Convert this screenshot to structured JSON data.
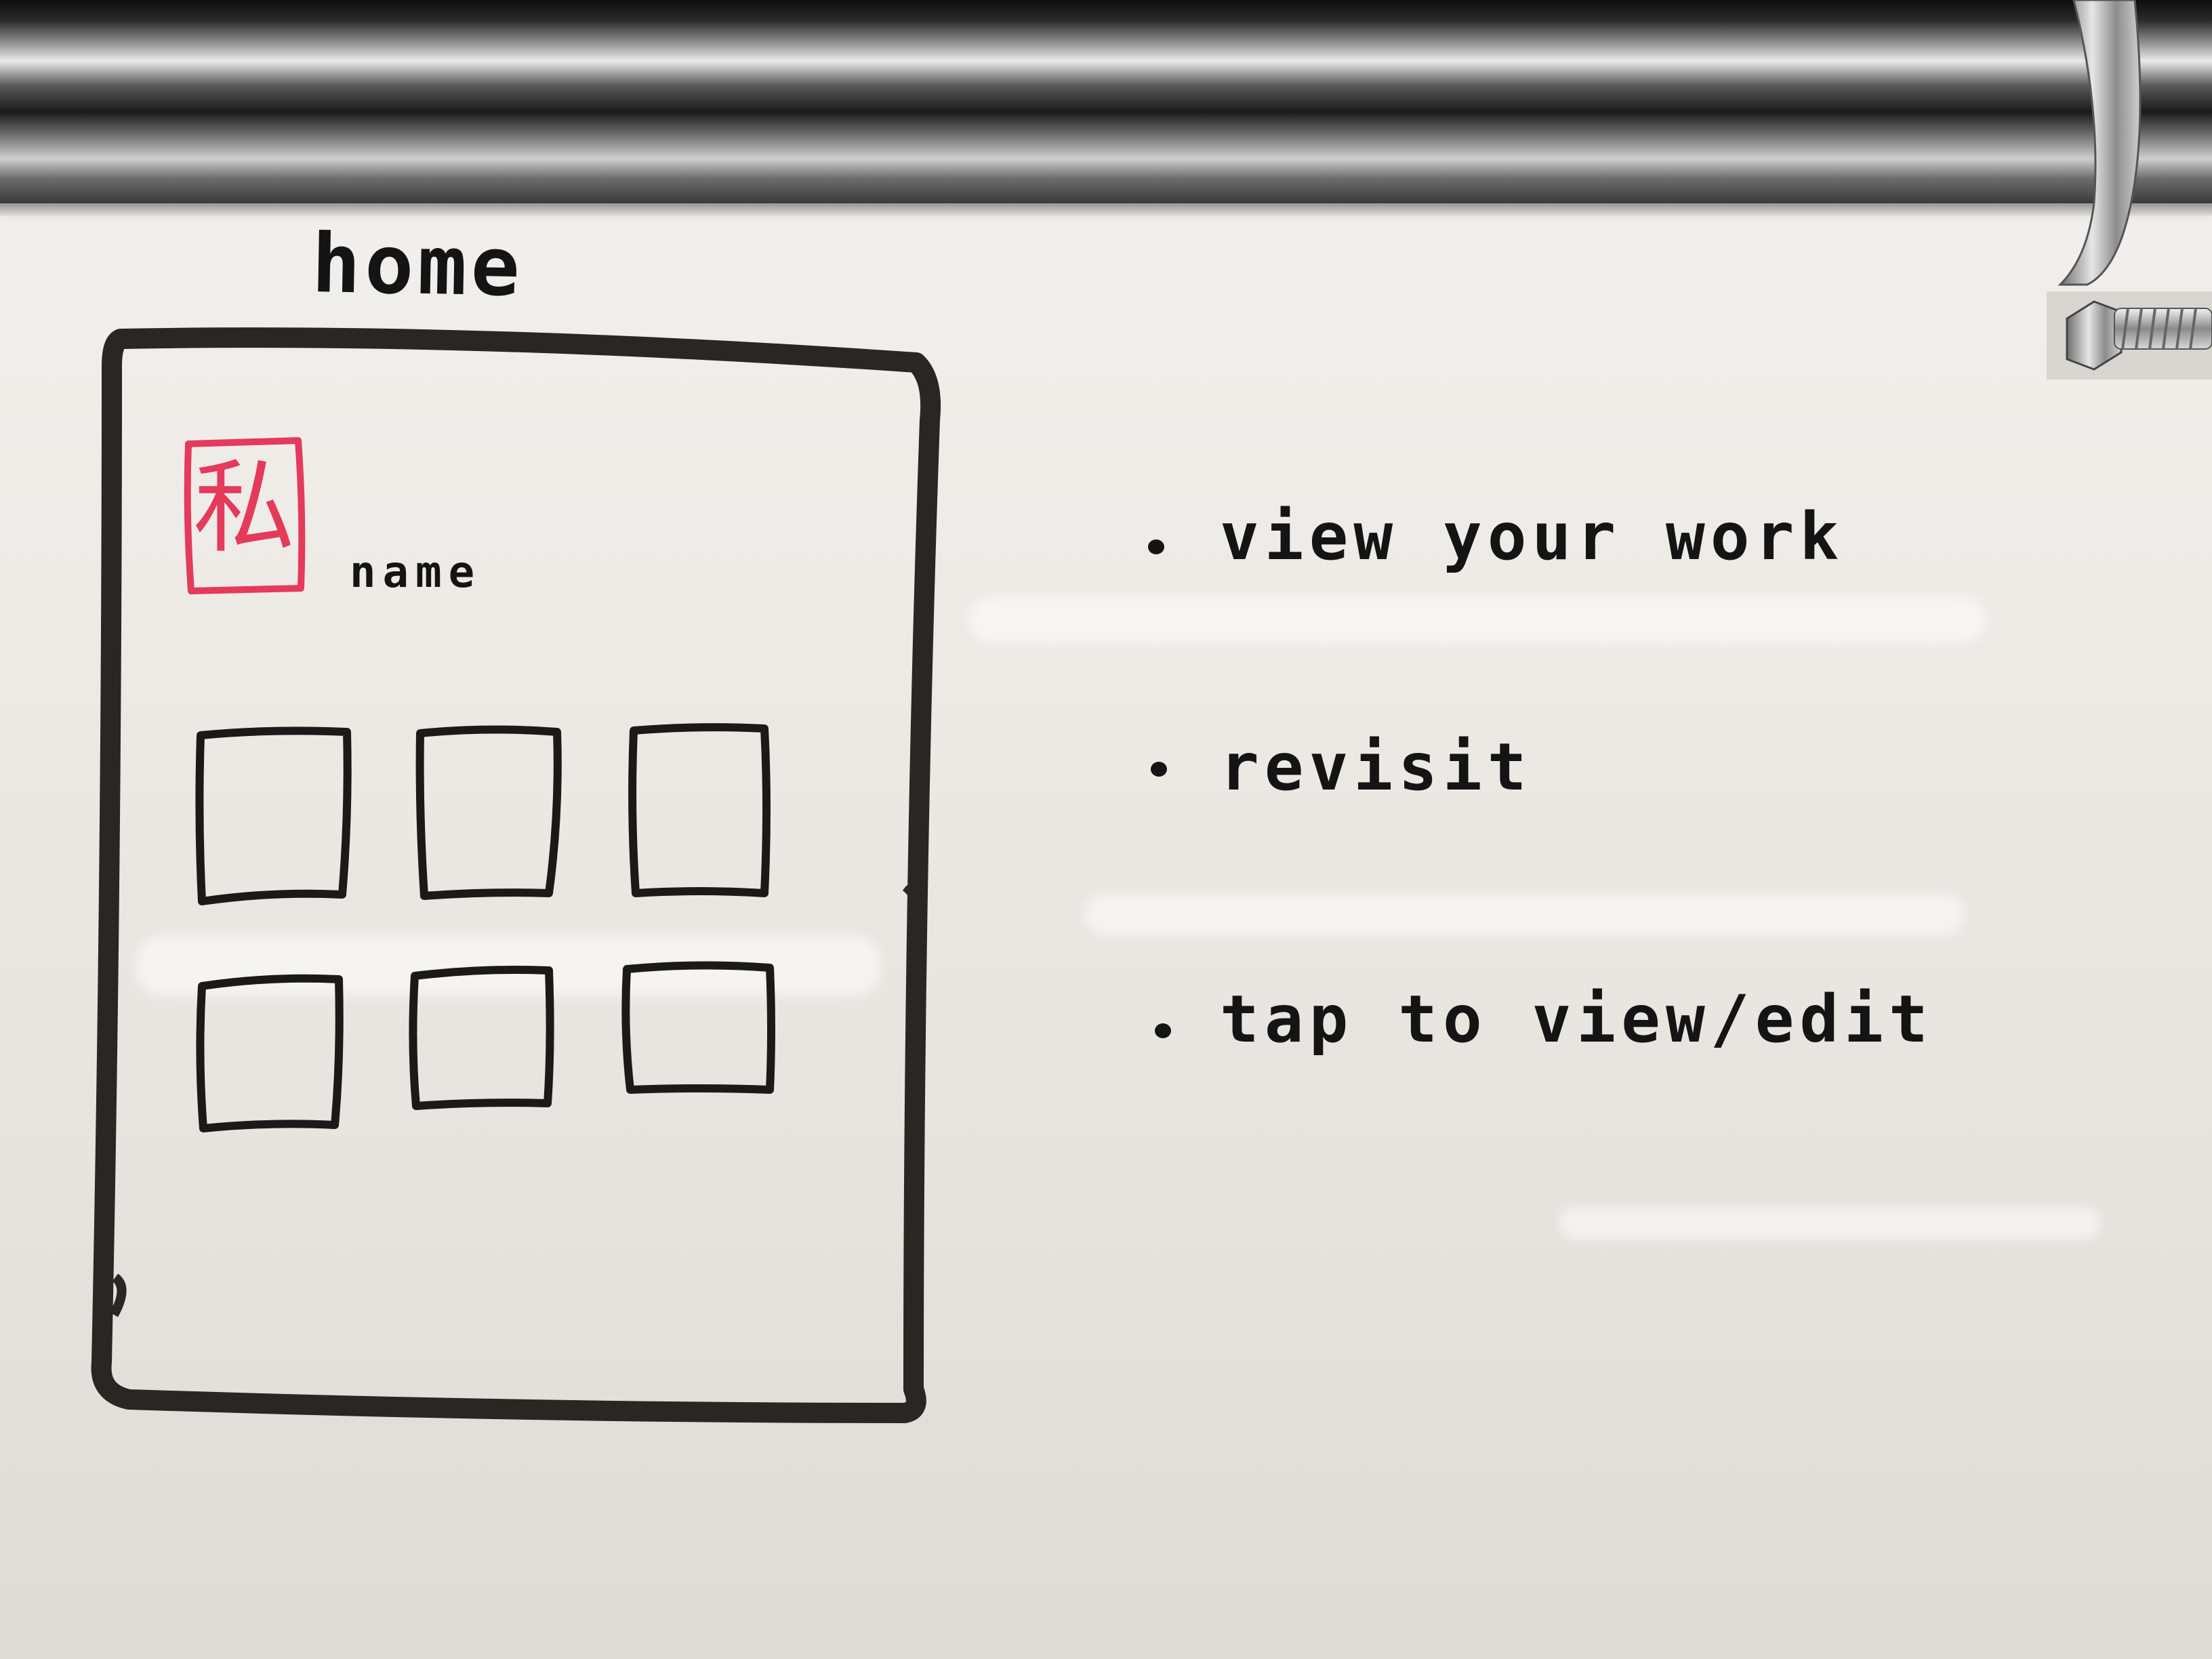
{
  "sketch": {
    "title": "home",
    "avatar_char": "私",
    "name_label": "name",
    "tile_count": 6
  },
  "bullets": [
    "view your work",
    "revisit",
    "tap to view/edit"
  ],
  "colors": {
    "marker_black": "#141414",
    "marker_red": "#e43a5c",
    "board": "#eeebe7",
    "rail": "#9a9a9a"
  }
}
